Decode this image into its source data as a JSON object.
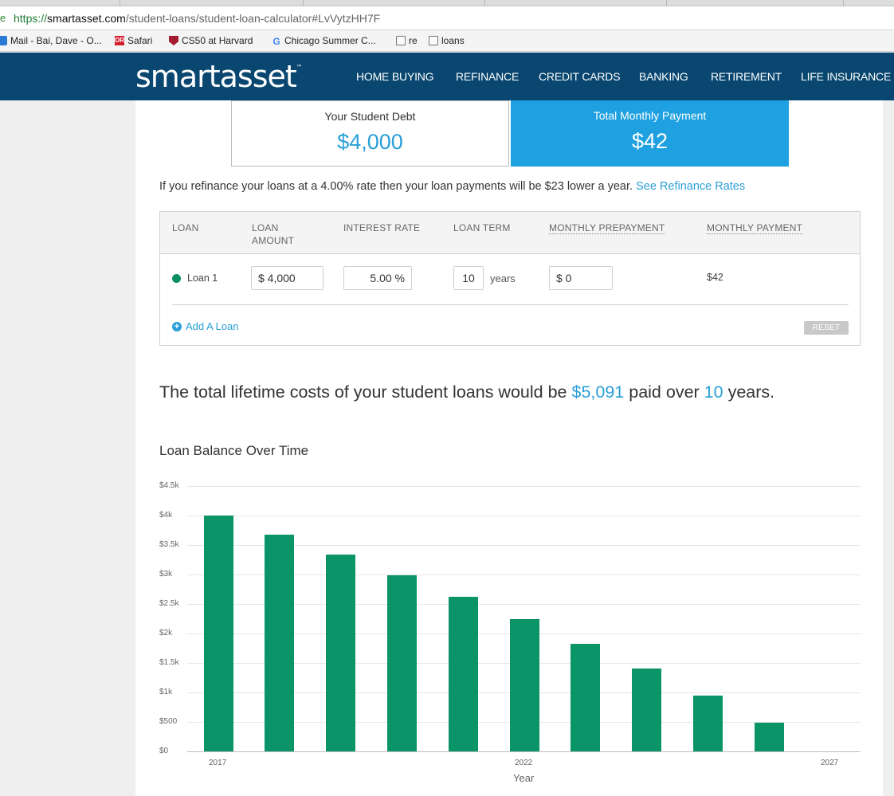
{
  "browser": {
    "url_protocol": "https://",
    "url_host": "smartasset.com",
    "url_path": "/student-loans/student-loan-calculator#LvVytzHH7F",
    "bookmarks": [
      {
        "label": "Mail - Bai, Dave - O...",
        "icon": "mail-icon"
      },
      {
        "label": "Safari",
        "icon": "safari-books-icon"
      },
      {
        "label": "CS50 at Harvard",
        "icon": "harvard-shield-icon"
      },
      {
        "label": "Chicago Summer C...",
        "icon": "google-icon"
      },
      {
        "label": "re",
        "icon": "folder-icon"
      },
      {
        "label": "loans",
        "icon": "folder-icon"
      }
    ]
  },
  "header": {
    "logo_text": "smartasset",
    "logo_tm": "™",
    "nav": [
      "HOME BUYING",
      "REFINANCE",
      "CREDIT CARDS",
      "BANKING",
      "RETIREMENT",
      "LIFE INSURANCE"
    ]
  },
  "summary": {
    "debt_label": "Your Student Debt",
    "debt_value": "$4,000",
    "payment_label": "Total Monthly Payment",
    "payment_value": "$42"
  },
  "refinance": {
    "text": "If you refinance your loans at a 4.00% rate then your loan payments will be $23 lower a year.",
    "link": "See Refinance Rates"
  },
  "loan_table": {
    "headers": {
      "loan": "LOAN",
      "loan_amount_1": "LOAN",
      "loan_amount_2": "AMOUNT",
      "interest_rate": "INTEREST RATE",
      "loan_term": "LOAN TERM",
      "monthly_prepayment": "MONTHLY PREPAYMENT",
      "monthly_payment": "MONTHLY PAYMENT"
    },
    "rows": [
      {
        "name": "Loan 1",
        "amount": "$ 4,000",
        "rate": "5.00",
        "rate_unit": "%",
        "term": "10",
        "term_unit": "years",
        "prepayment": "$ 0",
        "monthly_payment": "$42"
      }
    ],
    "add_loan": "Add A Loan",
    "reset": "RESET"
  },
  "lifetime": {
    "prefix": "The total lifetime costs of your student loans would be",
    "amount": "$5,091",
    "middle": "paid over",
    "years": "10",
    "suffix": "years."
  },
  "chart_title": "Loan Balance Over Time",
  "chart_data": {
    "type": "bar",
    "title": "Loan Balance Over Time",
    "xlabel": "Year",
    "ylabel": "",
    "categories": [
      "2017",
      "2018",
      "2019",
      "2020",
      "2021",
      "2022",
      "2023",
      "2024",
      "2025",
      "2026",
      "2027"
    ],
    "values": [
      4000,
      3680,
      3340,
      2990,
      2620,
      2240,
      1830,
      1400,
      950,
      480,
      0
    ],
    "ylim": [
      0,
      4500
    ],
    "yticks": [
      "$0",
      "$500",
      "$1k",
      "$1.5k",
      "$2k",
      "$2.5k",
      "$3k",
      "$3.5k",
      "$4k",
      "$4.5k"
    ],
    "xticks_shown": [
      "2017",
      "2022",
      "2027"
    ],
    "grid": true,
    "color": "#0a9467"
  }
}
